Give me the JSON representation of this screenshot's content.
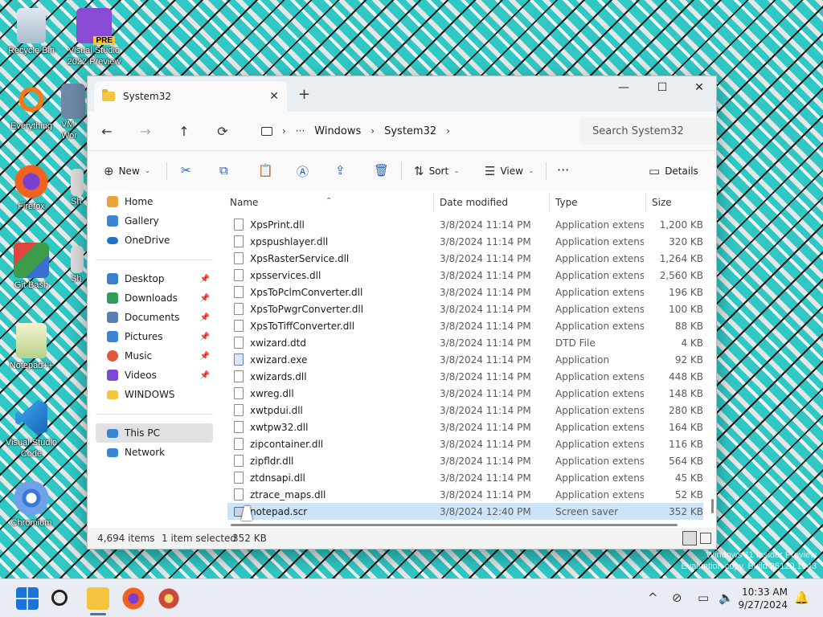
{
  "desktop": {
    "icons": [
      {
        "label": "Recycle Bin"
      },
      {
        "label": "Visual Studio 2022 Preview",
        "badge": "PRE"
      },
      {
        "label": "Everything"
      },
      {
        "label": "VM Wor"
      },
      {
        "label": "Firefox"
      },
      {
        "label": "Sh"
      },
      {
        "label": "Git Bash"
      },
      {
        "label": "Sh"
      },
      {
        "label": "Notepad++"
      },
      {
        "label": "Visual Studio Code"
      },
      {
        "label": "Chromium"
      }
    ],
    "watermark": [
      "Windows 11 Insider Preview",
      "Evaluation copy. Build 26120.1843"
    ]
  },
  "window": {
    "tab_title": "System32",
    "new_tab": "+",
    "controls": {
      "minimize": "—",
      "maximize": "☐",
      "close": "✕"
    },
    "nav": {
      "back": "←",
      "forward": "→",
      "up": "↑",
      "refresh": "⟳"
    },
    "breadcrumb": [
      "Windows",
      "System32"
    ],
    "search_placeholder": "Search System32",
    "toolbar": {
      "new_label": "New",
      "sort_label": "Sort",
      "view_label": "View",
      "more_label": "···",
      "details_label": "Details"
    },
    "sidebar": {
      "top": [
        {
          "label": "Home",
          "icon": "home-icon",
          "color": "#e8a33d"
        },
        {
          "label": "Gallery",
          "icon": "gallery-icon",
          "color": "#3a86d6"
        },
        {
          "label": "OneDrive",
          "icon": "cloud-icon",
          "color": "#1e73c8"
        }
      ],
      "quick": [
        {
          "label": "Desktop",
          "icon": "desktop-icon",
          "color": "#3b7fd1",
          "pinned": true
        },
        {
          "label": "Downloads",
          "icon": "download-icon",
          "color": "#2e9e58",
          "pinned": true
        },
        {
          "label": "Documents",
          "icon": "documents-icon",
          "color": "#5a7fb0",
          "pinned": true
        },
        {
          "label": "Pictures",
          "icon": "pictures-icon",
          "color": "#3a86d6",
          "pinned": true
        },
        {
          "label": "Music",
          "icon": "music-icon",
          "color": "#e05a3a",
          "pinned": true
        },
        {
          "label": "Videos",
          "icon": "videos-icon",
          "color": "#7b4bd1",
          "pinned": true
        },
        {
          "label": "WINDOWS",
          "icon": "folder-icon",
          "color": "#f5c542",
          "pinned": false
        }
      ],
      "bottom": [
        {
          "label": "This PC",
          "icon": "computer-icon",
          "color": "#3a86d6",
          "active": true
        },
        {
          "label": "Network",
          "icon": "network-icon",
          "color": "#3a86d6",
          "active": false
        }
      ],
      "pin_glyph": "📌"
    },
    "columns": {
      "name": "Name",
      "date": "Date modified",
      "type": "Type",
      "size": "Size"
    },
    "files": [
      {
        "name": "XpsPrint.dll",
        "date": "3/8/2024 11:14 PM",
        "type": "Application extens...",
        "size": "1,200 KB",
        "kind": "dll"
      },
      {
        "name": "xpspushlayer.dll",
        "date": "3/8/2024 11:14 PM",
        "type": "Application extens...",
        "size": "320 KB",
        "kind": "dll"
      },
      {
        "name": "XpsRasterService.dll",
        "date": "3/8/2024 11:14 PM",
        "type": "Application extens...",
        "size": "1,264 KB",
        "kind": "dll"
      },
      {
        "name": "xpsservices.dll",
        "date": "3/8/2024 11:14 PM",
        "type": "Application extens...",
        "size": "2,560 KB",
        "kind": "dll"
      },
      {
        "name": "XpsToPclmConverter.dll",
        "date": "3/8/2024 11:14 PM",
        "type": "Application extens...",
        "size": "196 KB",
        "kind": "dll"
      },
      {
        "name": "XpsToPwgrConverter.dll",
        "date": "3/8/2024 11:14 PM",
        "type": "Application extens...",
        "size": "100 KB",
        "kind": "dll"
      },
      {
        "name": "XpsToTiffConverter.dll",
        "date": "3/8/2024 11:14 PM",
        "type": "Application extens...",
        "size": "88 KB",
        "kind": "dll"
      },
      {
        "name": "xwizard.dtd",
        "date": "3/8/2024 11:14 PM",
        "type": "DTD File",
        "size": "4 KB",
        "kind": "file"
      },
      {
        "name": "xwizard.exe",
        "date": "3/8/2024 11:14 PM",
        "type": "Application",
        "size": "92 KB",
        "kind": "exe"
      },
      {
        "name": "xwizards.dll",
        "date": "3/8/2024 11:14 PM",
        "type": "Application extens...",
        "size": "448 KB",
        "kind": "dll"
      },
      {
        "name": "xwreg.dll",
        "date": "3/8/2024 11:14 PM",
        "type": "Application extens...",
        "size": "148 KB",
        "kind": "dll"
      },
      {
        "name": "xwtpdui.dll",
        "date": "3/8/2024 11:14 PM",
        "type": "Application extens...",
        "size": "280 KB",
        "kind": "dll"
      },
      {
        "name": "xwtpw32.dll",
        "date": "3/8/2024 11:14 PM",
        "type": "Application extens...",
        "size": "164 KB",
        "kind": "dll"
      },
      {
        "name": "zipcontainer.dll",
        "date": "3/8/2024 11:14 PM",
        "type": "Application extens...",
        "size": "116 KB",
        "kind": "dll"
      },
      {
        "name": "zipfldr.dll",
        "date": "3/8/2024 11:14 PM",
        "type": "Application extens...",
        "size": "564 KB",
        "kind": "dll"
      },
      {
        "name": "ztdnsapi.dll",
        "date": "3/8/2024 11:14 PM",
        "type": "Application extens...",
        "size": "45 KB",
        "kind": "dll"
      },
      {
        "name": "ztrace_maps.dll",
        "date": "3/8/2024 11:14 PM",
        "type": "Application extens...",
        "size": "52 KB",
        "kind": "dll"
      },
      {
        "name": "notepad.scr",
        "date": "3/8/2024 12:40 PM",
        "type": "Screen saver",
        "size": "352 KB",
        "kind": "scr",
        "selected": true
      }
    ],
    "status": {
      "items": "4,694 items",
      "selected": "1 item selected",
      "size": "352 KB"
    }
  },
  "taskbar": {
    "time": "10:33 AM",
    "date": "9/27/2024",
    "tray": {
      "chevron": "^",
      "bell": "🔔"
    }
  }
}
